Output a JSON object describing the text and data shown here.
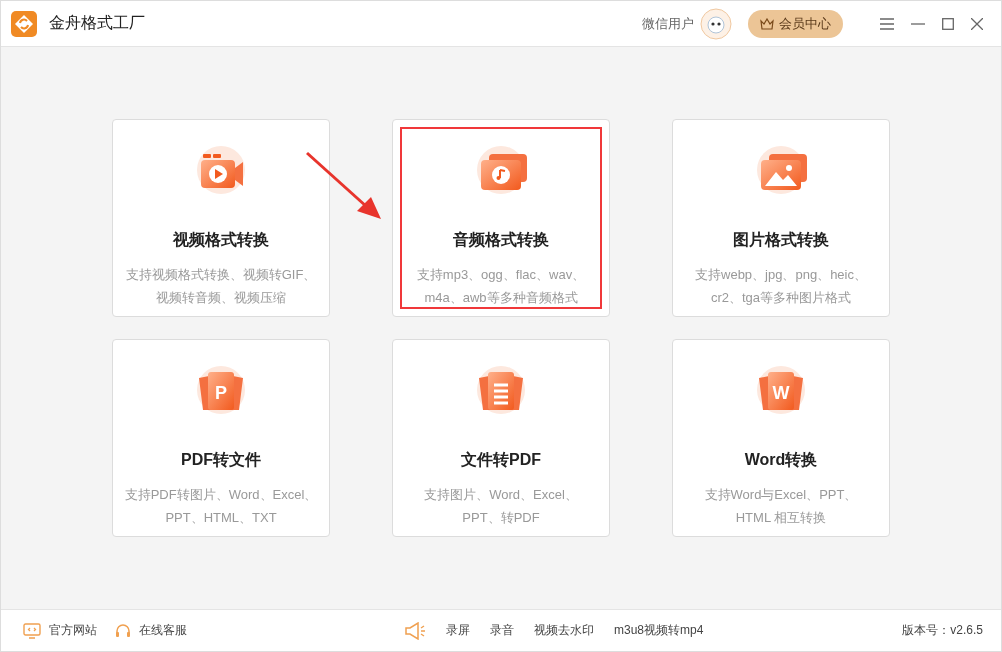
{
  "window": {
    "title": "金舟格式工厂"
  },
  "user": {
    "name": "微信用户"
  },
  "vip_button": {
    "label": "会员中心"
  },
  "cards": [
    {
      "kind": "video",
      "title": "视频格式转换",
      "description_lines": [
        "支持视频格式转换、视频转GIF、",
        "视频转音频、视频压缩"
      ],
      "highlighted": false
    },
    {
      "kind": "audio",
      "title": "音频格式转换",
      "description_lines": [
        "支持mp3、ogg、flac、wav、",
        "m4a、awb等多种音频格式"
      ],
      "highlighted": true
    },
    {
      "kind": "image",
      "title": "图片格式转换",
      "description_lines": [
        "支持webp、jpg、png、heic、",
        "cr2、tga等多种图片格式"
      ],
      "highlighted": false
    },
    {
      "kind": "letter",
      "icon_letter": "P",
      "title": "PDF转文件",
      "description_lines": [
        "支持PDF转图片、Word、Excel、",
        "PPT、HTML、TXT"
      ],
      "highlighted": false
    },
    {
      "kind": "document",
      "title": "文件转PDF",
      "description_lines": [
        "支持图片、Word、Excel、",
        "PPT、转PDF"
      ],
      "highlighted": false
    },
    {
      "kind": "letter",
      "icon_letter": "W",
      "title": "Word转换",
      "description_lines": [
        "支持Word与Excel、PPT、",
        "HTML 相互转换"
      ],
      "highlighted": false
    }
  ],
  "pointer_arrow": true,
  "footer": {
    "links": [
      {
        "kind": "monitor",
        "label": "官方网站"
      },
      {
        "kind": "headset",
        "label": "在线客服"
      }
    ],
    "tools": [
      "录屏",
      "录音",
      "视频去水印",
      "m3u8视频转mp4"
    ],
    "version": "版本号：v2.6.5"
  }
}
